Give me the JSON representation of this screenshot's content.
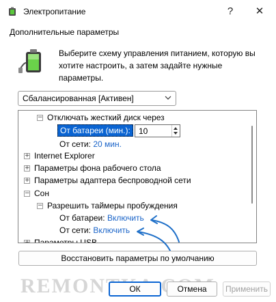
{
  "window": {
    "title": "Электропитание",
    "help": "?",
    "close": "✕"
  },
  "section_label": "Дополнительные параметры",
  "description": "Выберите схему управления питанием, которую вы хотите настроить, а затем задайте нужные параметры.",
  "scheme_select": {
    "value": "Сбалансированная [Активен]"
  },
  "tree": {
    "harddisk": {
      "label": "Отключать жесткий диск через",
      "battery_label": "От батареи (мин.):",
      "battery_value": "10",
      "ac_label": "От сети:",
      "ac_value": "20 мин."
    },
    "ie": "Internet Explorer",
    "desktop_bg": "Параметры фона рабочего стола",
    "wireless": "Параметры адаптера беспроводной сети",
    "sleep": "Сон",
    "wake_timers": {
      "label": "Разрешить таймеры пробуждения",
      "battery_label": "От батареи:",
      "battery_value": "Включить",
      "ac_label": "От сети:",
      "ac_value": "Включить"
    },
    "usb": "Параметры USB"
  },
  "restore_button": "Восстановить параметры по умолчанию",
  "watermark": "REMONTKA.COM",
  "buttons": {
    "ok": "ОК",
    "cancel": "Отмена",
    "apply": "Применить"
  },
  "colors": {
    "accent": "#0a64d2",
    "link": "#1a64c8",
    "arrow": "#1e6fc8"
  }
}
